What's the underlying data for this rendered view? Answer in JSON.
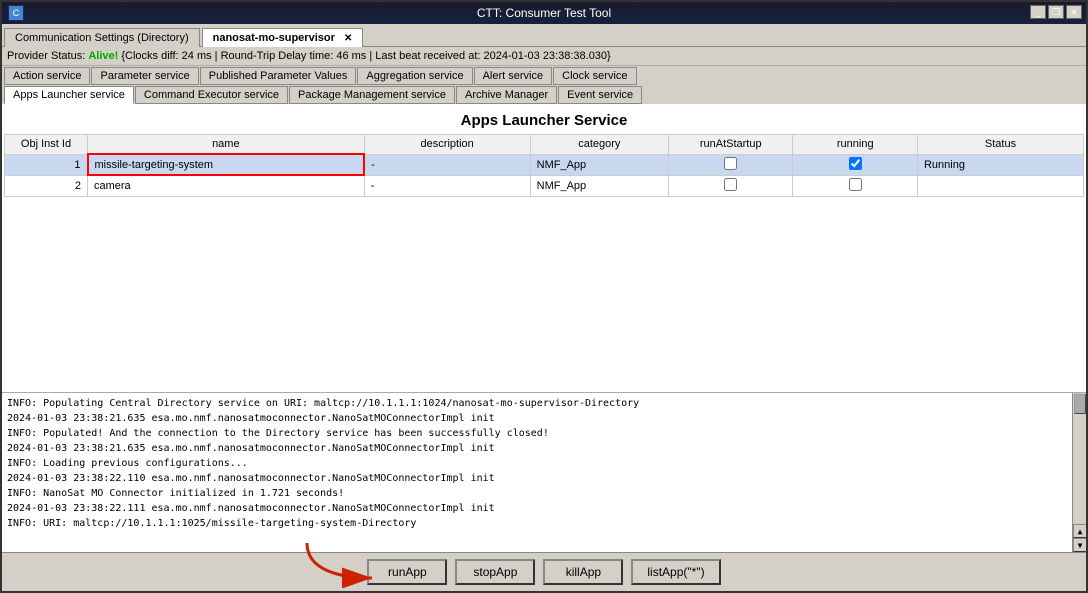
{
  "window": {
    "title": "CTT: Consumer Test Tool",
    "icon": "app-icon"
  },
  "tabs": [
    {
      "label": "Communication Settings (Directory)",
      "active": false
    },
    {
      "label": "nanosat-mo-supervisor",
      "active": true,
      "closable": true
    }
  ],
  "titlebar_controls": [
    "minimize",
    "restore",
    "close"
  ],
  "status_bar": {
    "prefix": "Provider Status:",
    "alive_text": "Alive!",
    "details": "{Clocks diff: 24 ms | Round-Trip Delay time: 46 ms | Last beat received at: 2024-01-03 23:38:38.030}"
  },
  "service_tabs_row1": [
    {
      "label": "Action service",
      "active": false
    },
    {
      "label": "Parameter service",
      "active": false
    },
    {
      "label": "Published Parameter Values",
      "active": false
    },
    {
      "label": "Aggregation service",
      "active": false
    },
    {
      "label": "Alert service",
      "active": false
    },
    {
      "label": "Clock service",
      "active": false
    }
  ],
  "service_tabs_row2": [
    {
      "label": "Apps Launcher service",
      "active": true
    },
    {
      "label": "Command Executor service",
      "active": false
    },
    {
      "label": "Package Management service",
      "active": false
    },
    {
      "label": "Archive Manager",
      "active": false
    },
    {
      "label": "Event service",
      "active": false
    }
  ],
  "main": {
    "title": "Apps Launcher Service",
    "table": {
      "columns": [
        "Obj Inst Id",
        "name",
        "description",
        "category",
        "runAtStartup",
        "running",
        "Status"
      ],
      "rows": [
        {
          "id": "1",
          "name": "missile-targeting-system",
          "description": "-",
          "category": "NMF_App",
          "runAtStartup": false,
          "running": true,
          "status": "Running",
          "selected": true,
          "name_highlighted": true
        },
        {
          "id": "2",
          "name": "camera",
          "description": "-",
          "category": "NMF_App",
          "runAtStartup": false,
          "running": false,
          "status": "",
          "selected": false,
          "name_highlighted": false
        }
      ]
    }
  },
  "log": {
    "lines": [
      "INFO: Populating Central Directory service on URI: maltcp://10.1.1.1:1024/nanosat-mo-supervisor-Directory",
      "2024-01-03 23:38:21.635 esa.mo.nmf.nanosatmoconnector.NanoSatMOConnectorImpl init",
      "INFO: Populated! And the connection to the Directory service has been successfully closed!",
      "2024-01-03 23:38:21.635 esa.mo.nmf.nanosatmoconnector.NanoSatMOConnectorImpl init",
      "INFO: Loading previous configurations...",
      "2024-01-03 23:38:22.110 esa.mo.nmf.nanosatmoconnector.NanoSatMOConnectorImpl init",
      "INFO: NanoSat MO Connector initialized in 1.721 seconds!",
      "2024-01-03 23:38:22.111 esa.mo.nmf.nanosatmoconnector.NanoSatMOConnectorImpl init",
      "INFO: URI: maltcp://10.1.1.1:1025/missile-targeting-system-Directory"
    ]
  },
  "buttons": [
    {
      "label": "runApp",
      "name": "run-app-button"
    },
    {
      "label": "stopApp",
      "name": "stop-app-button"
    },
    {
      "label": "killApp",
      "name": "kill-app-button"
    },
    {
      "label": "listApp(\"*\")",
      "name": "list-app-button"
    }
  ]
}
